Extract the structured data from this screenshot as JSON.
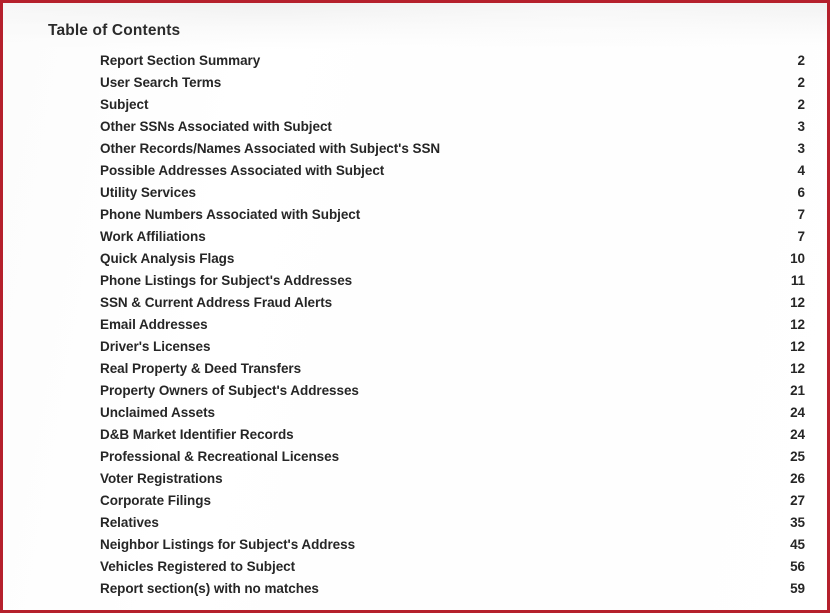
{
  "document": {
    "title": "Table of Contents",
    "border_color": "#b5202c",
    "background_color": "#ffffff",
    "text_color": "#262626"
  },
  "toc": {
    "heading": "Table of Contents",
    "entries": [
      {
        "label": "Report Section Summary",
        "page": "2"
      },
      {
        "label": "User Search Terms",
        "page": "2"
      },
      {
        "label": "Subject",
        "page": "2"
      },
      {
        "label": "Other SSNs Associated with Subject",
        "page": "3"
      },
      {
        "label": "Other Records/Names Associated with Subject's SSN",
        "page": "3"
      },
      {
        "label": "Possible Addresses Associated with Subject",
        "page": "4"
      },
      {
        "label": "Utility Services",
        "page": "6"
      },
      {
        "label": "Phone Numbers Associated with Subject",
        "page": "7"
      },
      {
        "label": "Work Affiliations",
        "page": "7"
      },
      {
        "label": "Quick Analysis Flags",
        "page": "10"
      },
      {
        "label": "Phone Listings for Subject's Addresses",
        "page": "11"
      },
      {
        "label": "SSN & Current Address Fraud Alerts",
        "page": "12"
      },
      {
        "label": "Email Addresses",
        "page": "12"
      },
      {
        "label": "Driver's Licenses",
        "page": "12"
      },
      {
        "label": "Real Property & Deed Transfers",
        "page": "12"
      },
      {
        "label": "Property Owners of Subject's Addresses",
        "page": "21"
      },
      {
        "label": "Unclaimed Assets",
        "page": "24"
      },
      {
        "label": "D&B Market Identifier Records",
        "page": "24"
      },
      {
        "label": "Professional & Recreational Licenses",
        "page": "25"
      },
      {
        "label": "Voter Registrations",
        "page": "26"
      },
      {
        "label": "Corporate Filings",
        "page": "27"
      },
      {
        "label": "Relatives",
        "page": "35"
      },
      {
        "label": "Neighbor Listings for Subject's Address",
        "page": "45"
      },
      {
        "label": "Vehicles Registered to Subject",
        "page": "56"
      },
      {
        "label": "Report section(s) with no matches",
        "page": "59"
      }
    ]
  }
}
